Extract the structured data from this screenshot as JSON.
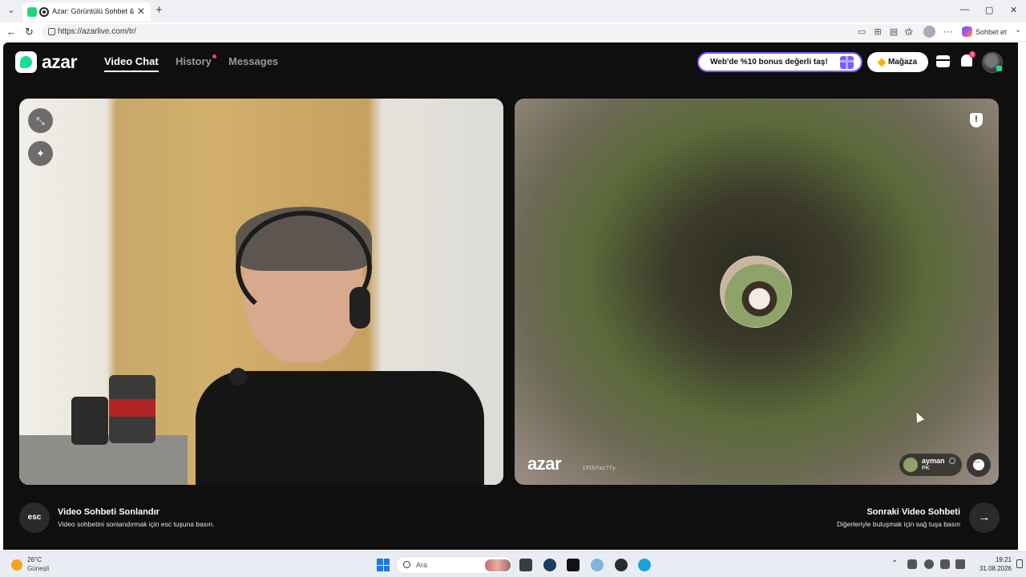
{
  "browser": {
    "tab_title": "Azar: Görüntülü Sohbet & Yen",
    "tab_close": "✕",
    "new_tab": "+",
    "url": "https://azarlive.com/tr/",
    "copilot_label": "Sohbet et",
    "window_controls": {
      "minimize": "—",
      "maximize": "▢",
      "close": "✕"
    }
  },
  "app": {
    "logo_text": "azar",
    "nav": {
      "video_chat": "Video Chat",
      "history": "History",
      "messages": "Messages"
    },
    "promo_text": "Web'de %10 bonus değerli taş!",
    "store_label": "Mağaza",
    "notification_badge": "1",
    "brand_colors": {
      "accent": "#17e094",
      "promo_border": "#7b5cff",
      "badge": "#ff3d6a",
      "background": "#0f0f0f"
    }
  },
  "remote_video": {
    "watermark_logo": "azar",
    "watermark_id": "191bYaz7fy",
    "peer": {
      "name": "ayman",
      "country": "PK"
    }
  },
  "controls": {
    "esc_label": "esc",
    "end_title": "Video Sohbeti Sonlandır",
    "end_subtitle": "Video sohbetini sonlandırmak için esc tuşuna basın.",
    "next_title": "Sonraki Video Sohbeti",
    "next_subtitle": "Diğerleriyle buluşmak için sağ tuşa basın"
  },
  "taskbar": {
    "weather_temp": "26°C",
    "weather_condition": "Güneşli",
    "search_placeholder": "Ara",
    "time": "19:21",
    "date": "31.08.2026"
  }
}
